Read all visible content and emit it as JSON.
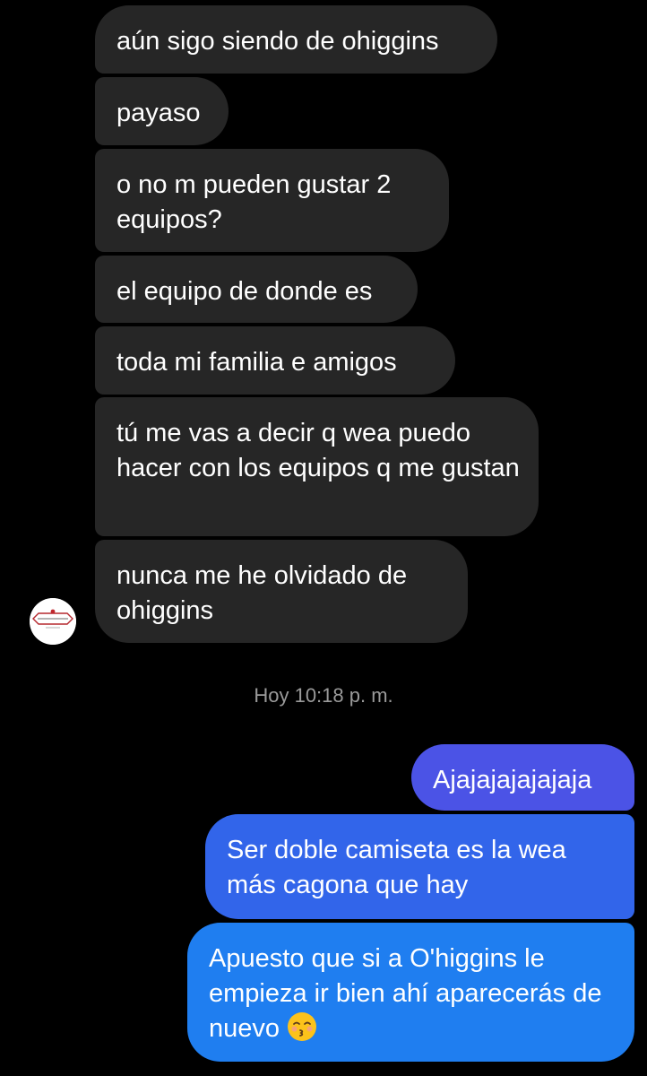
{
  "incoming_messages": [
    {
      "text": "aún sigo siendo de ohiggins"
    },
    {
      "text": "payaso"
    },
    {
      "text": "o no m pueden gustar 2 equipos?"
    },
    {
      "text": "el equipo de donde es"
    },
    {
      "text": "toda mi familia e amigos"
    },
    {
      "text": "tú me vas a decir q wea puedo hacer con los equipos q me gustan"
    },
    {
      "text": "nunca me he olvidado de ohiggins"
    }
  ],
  "timestamp": "Hoy 10:18 p. m.",
  "outgoing_messages": [
    {
      "text": "Ajajajajajajaja"
    },
    {
      "text": "Ser doble camiseta es la wea más cagona que hay"
    },
    {
      "text": "Apuesto que si a O'higgins le empieza ir bien ahí aparecerás de nuevo",
      "emoji": "kissing-closed-eyes-emoji"
    }
  ],
  "colors": {
    "background": "#000000",
    "incoming_bubble": "#262626",
    "outgoing_top": "#4b53e6",
    "outgoing_mid": "#3265ea",
    "outgoing_bottom": "#1f7ef0",
    "timestamp_text": "#9a9a9a"
  }
}
